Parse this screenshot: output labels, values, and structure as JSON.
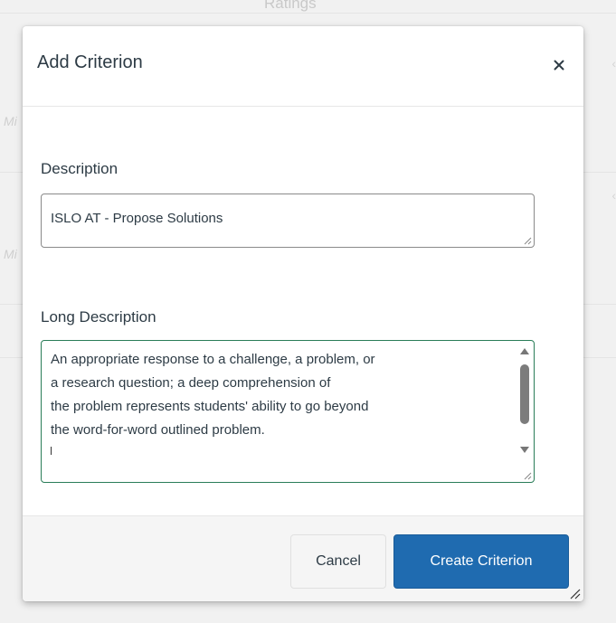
{
  "background": {
    "header_text": "Ratings",
    "row_fragment": "Mi"
  },
  "modal": {
    "title": "Add Criterion",
    "close_label": "×",
    "description": {
      "label": "Description",
      "value": "ISLO AT - Propose Solutions"
    },
    "long_description": {
      "label": "Long Description",
      "lines": [
        "An appropriate response to a challenge, a problem, or",
        "a research question; a deep comprehension of",
        "the problem represents students' ability to go beyond",
        "the word-for-word outlined problem."
      ]
    },
    "buttons": {
      "cancel": "Cancel",
      "create": "Create Criterion"
    }
  },
  "colors": {
    "primary": "#1f6bb0",
    "focus_border": "#2a7d58",
    "text": "#2d3b45"
  }
}
